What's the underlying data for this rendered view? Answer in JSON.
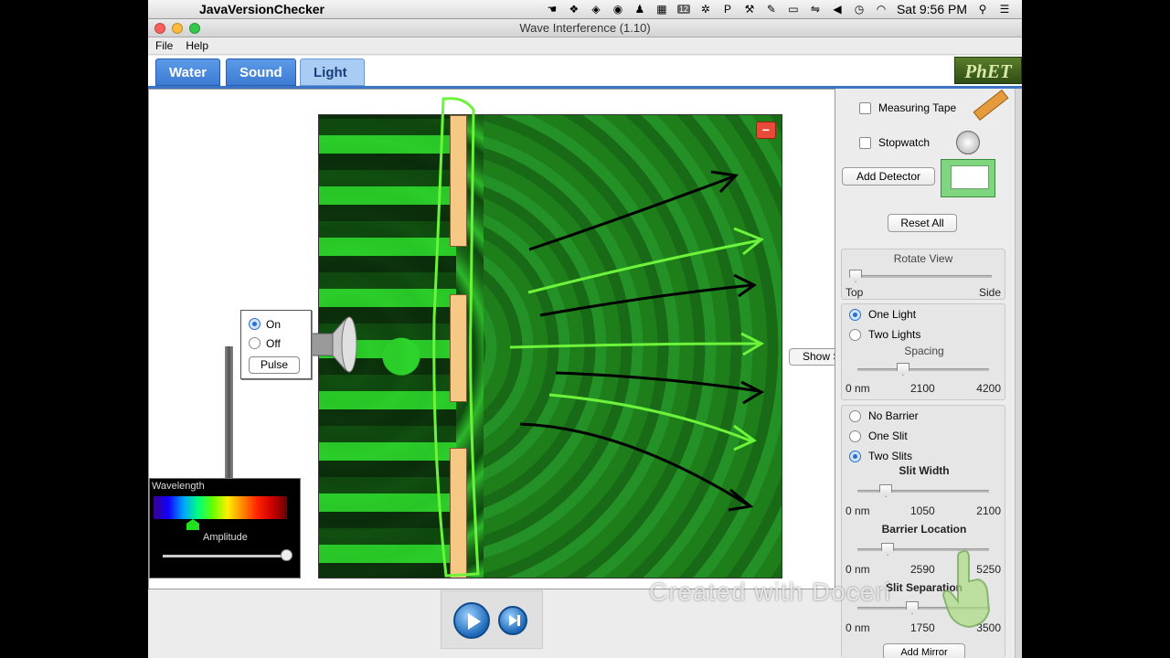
{
  "menubar": {
    "app_name": "JavaVersionChecker",
    "badge": "12",
    "clock": "Sat 9:56 PM"
  },
  "window": {
    "title": "Wave Interference (1.10)",
    "menus": [
      "File",
      "Help"
    ]
  },
  "tabs": [
    {
      "label": "Water",
      "active": false
    },
    {
      "label": "Sound",
      "active": false
    },
    {
      "label": "Light",
      "active": true
    }
  ],
  "logo_text": "PhET",
  "light_control": {
    "on_label": "On",
    "off_label": "Off",
    "pulse_label": "Pulse",
    "selected": "On"
  },
  "wavelength_panel": {
    "title": "Wavelength",
    "amplitude_label": "Amplitude"
  },
  "show_button_label": "Show S",
  "side_panel": {
    "measuring_tape_label": "Measuring Tape",
    "stopwatch_label": "Stopwatch",
    "add_detector_label": "Add Detector",
    "reset_all_label": "Reset All",
    "rotate_view": {
      "title": "Rotate View",
      "min_label": "Top",
      "max_label": "Side",
      "value": 0.0
    },
    "lights": {
      "one_light": "One Light",
      "two_lights": "Two Lights",
      "selected": "One Light",
      "spacing_title": "Spacing",
      "spacing_ticks": [
        "0 nm",
        "2100",
        "4200"
      ],
      "spacing_value": 0.45
    },
    "barrier": {
      "no_barrier": "No Barrier",
      "one_slit": "One Slit",
      "two_slits": "Two Slits",
      "selected": "Two Slits",
      "slit_width_title": "Slit Width",
      "slit_width_ticks": [
        "0 nm",
        "1050",
        "2100"
      ],
      "slit_width_value": 0.2,
      "barrier_location_title": "Barrier Location",
      "barrier_location_ticks": [
        "0 nm",
        "2590",
        "5250"
      ],
      "barrier_location_value": 0.2,
      "slit_separation_title": "Slit Separation",
      "slit_separation_ticks": [
        "0 nm",
        "1750",
        "3500"
      ],
      "slit_separation_value": 0.4
    },
    "add_mirror_label": "Add Mirror"
  },
  "watermark": "Created with Doceri",
  "colors": {
    "tab_blue": "#3d7bd4",
    "tab_active": "#a9ccf4",
    "wave_green": "#2db52a",
    "barrier_tan": "#f5c983",
    "annotation_black": "#000000",
    "annotation_green": "#6cf33a"
  }
}
